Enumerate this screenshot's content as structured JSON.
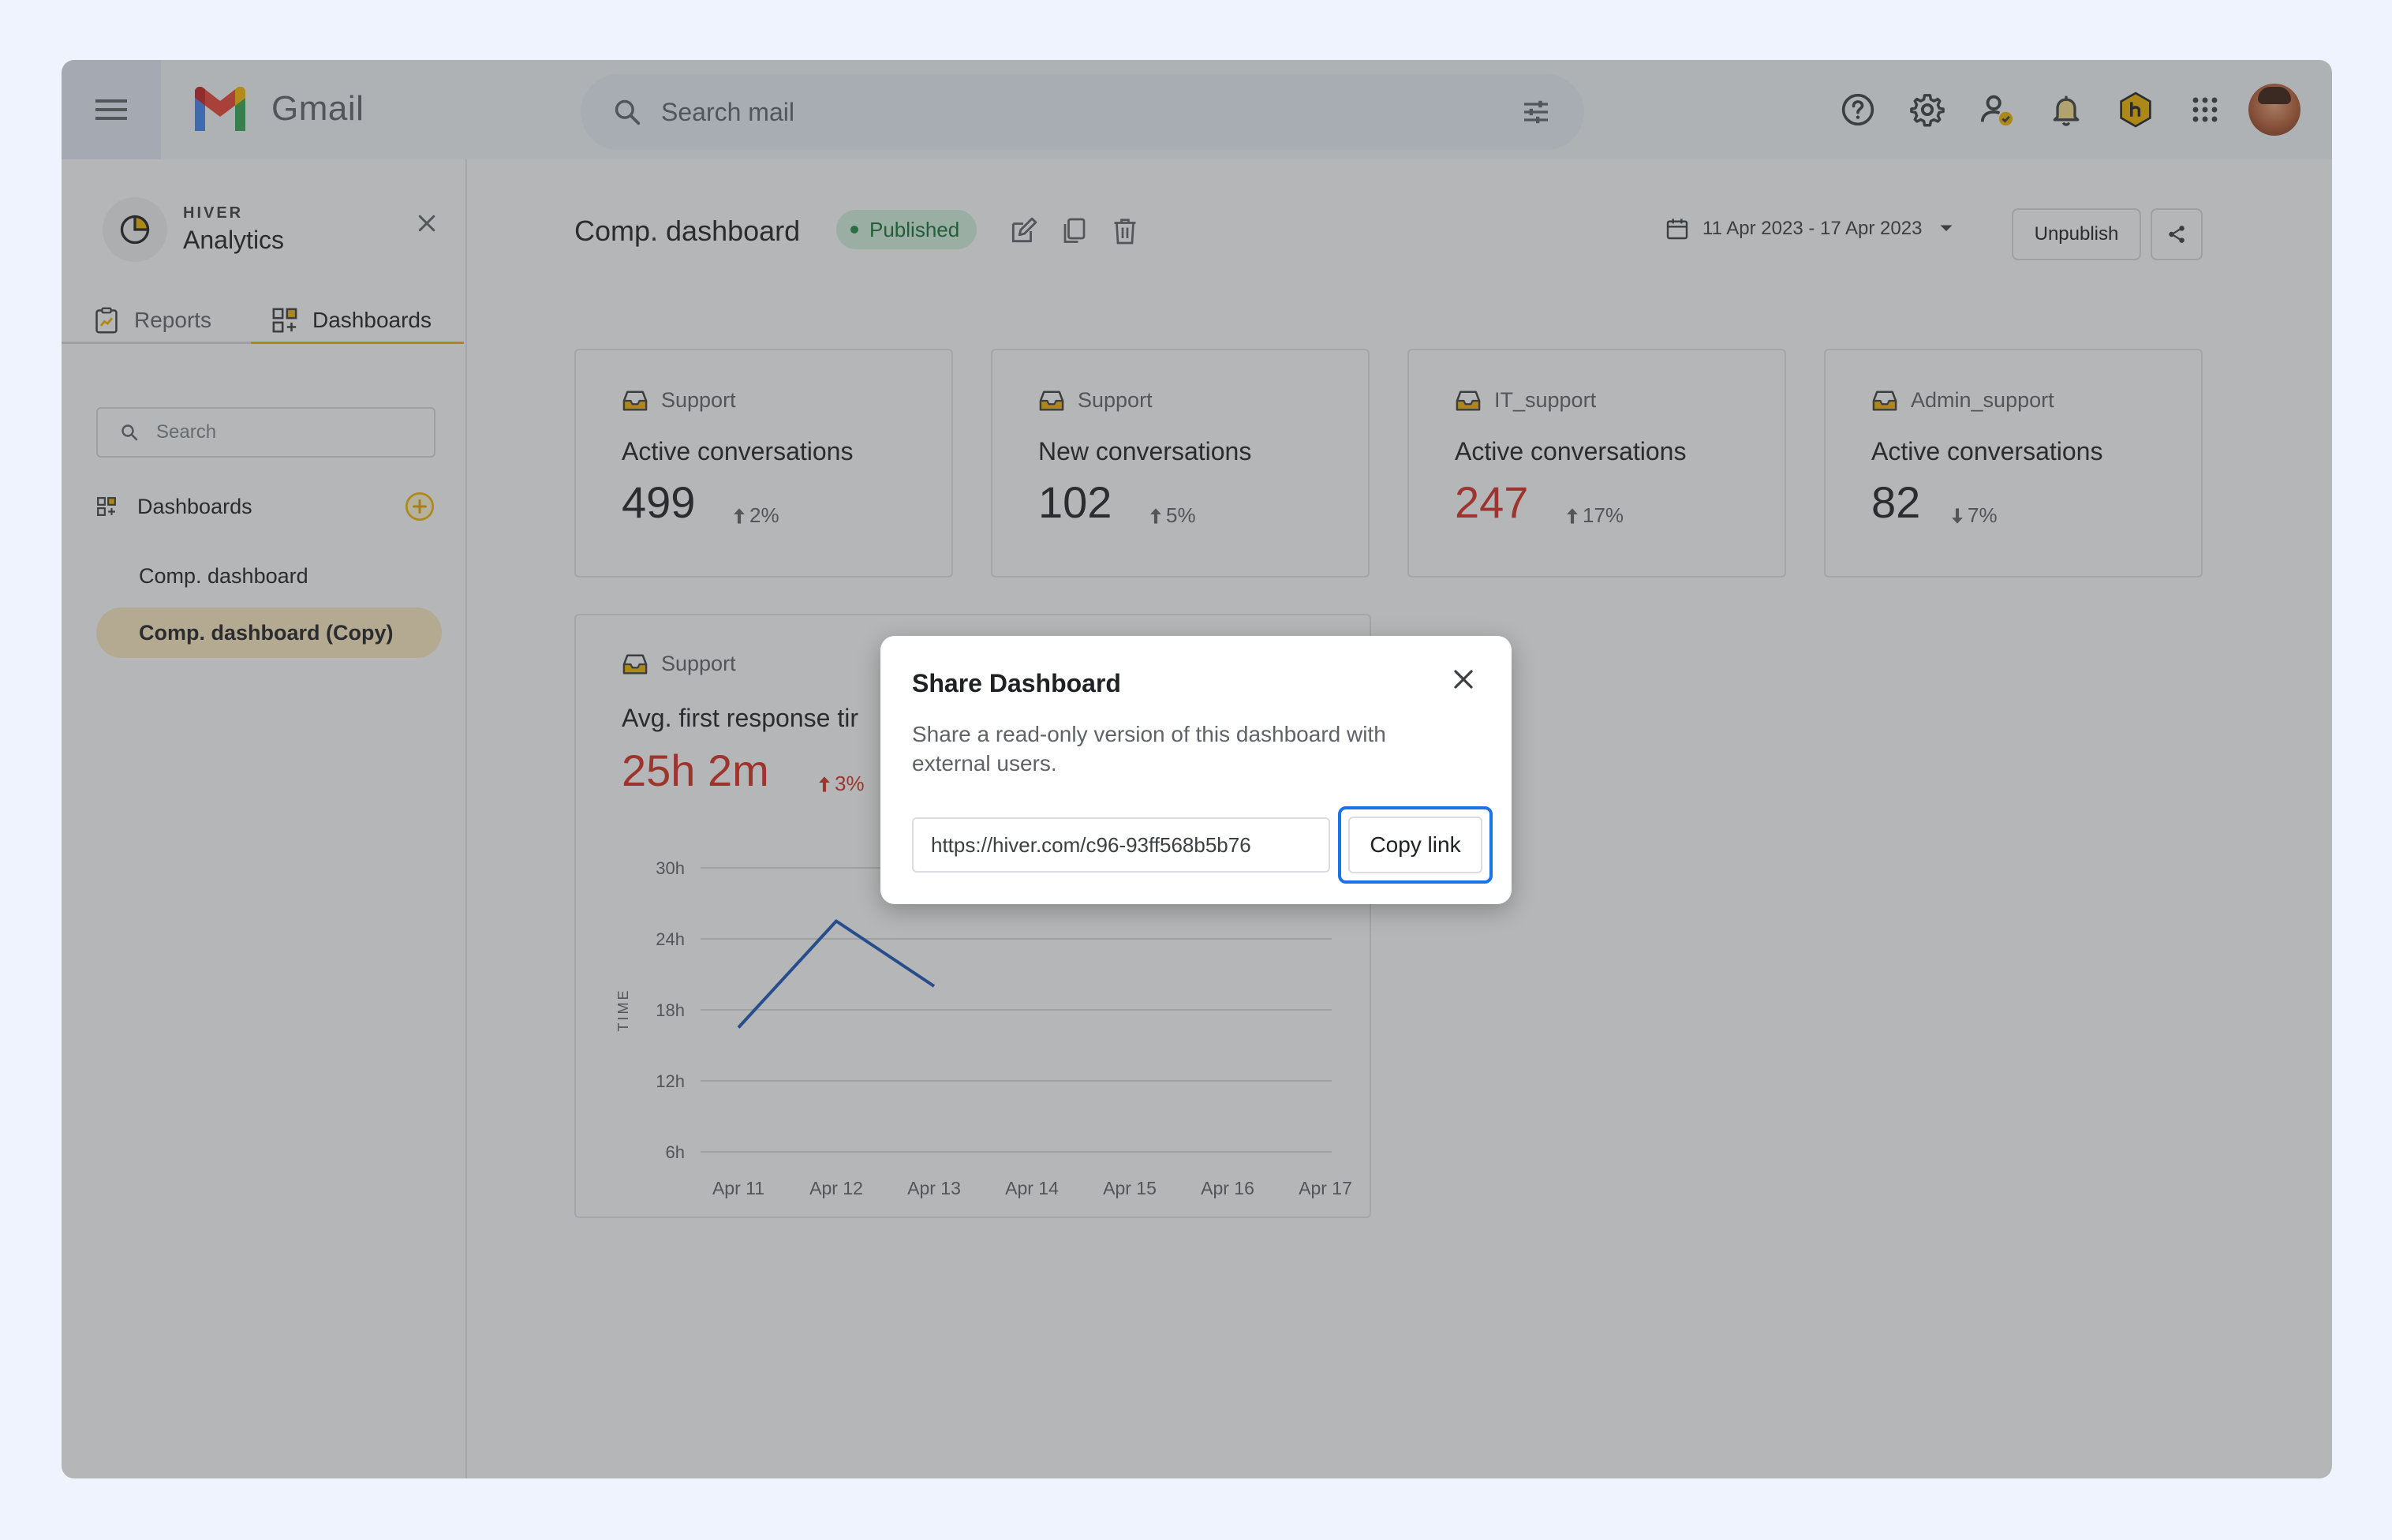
{
  "gmail": {
    "logo_text": "Gmail",
    "search_placeholder": "Search mail"
  },
  "sidebar": {
    "brand": "HIVER",
    "app_name": "Analytics",
    "tabs": [
      {
        "label": "Reports"
      },
      {
        "label": "Dashboards",
        "active": true
      }
    ],
    "search_placeholder": "Search",
    "section_label": "Dashboards",
    "items": [
      {
        "label": "Comp. dashboard"
      },
      {
        "label": "Comp. dashboard (Copy)",
        "selected": true
      }
    ]
  },
  "dashboard": {
    "title": "Comp. dashboard",
    "status": "Published",
    "date_range": "11 Apr 2023 - 17 Apr 2023",
    "unpublish_label": "Unpublish",
    "cards": [
      {
        "team": "Support",
        "metric": "Active conversations",
        "value": "499",
        "delta": "2%",
        "direction": "up"
      },
      {
        "team": "Support",
        "metric": "New conversations",
        "value": "102",
        "delta": "5%",
        "direction": "up"
      },
      {
        "team": "IT_support",
        "metric": "Active conversations",
        "value": "247",
        "delta": "17%",
        "direction": "up",
        "value_color": "#d93025"
      },
      {
        "team": "Admin_support",
        "metric": "Active conversations",
        "value": "82",
        "delta": "7%",
        "direction": "down"
      }
    ],
    "chart_card": {
      "team": "Support",
      "metric": "Avg. first response tir",
      "value": "25h 2m",
      "delta": "3%"
    }
  },
  "chart_data": {
    "type": "line",
    "title": "",
    "xlabel": "",
    "ylabel": "TIME",
    "categories": [
      "Apr 11",
      "Apr 12",
      "Apr 13"
    ],
    "series": [
      {
        "values": [
          16.5,
          25.5,
          20
        ]
      }
    ],
    "y_ticks": [
      "6h",
      "12h",
      "18h",
      "24h",
      "30h"
    ],
    "y_tick_values": [
      6,
      12,
      18,
      24,
      30
    ],
    "x_ticks": [
      "Apr 11",
      "Apr 12",
      "Apr 13",
      "Apr 14",
      "Apr 15",
      "Apr 16",
      "Apr 17"
    ],
    "ylim": [
      6,
      30
    ],
    "grid": true,
    "line_color": "#1a56b8",
    "partially_hidden_by_modal": true
  },
  "modal": {
    "title": "Share Dashboard",
    "description": "Share a read-only version of this dashboard with external users.",
    "link_value": "https://hiver.com/c96-93ff568b5b76",
    "copy_label": "Copy link"
  },
  "colors": {
    "accent": "#f2b500",
    "published_bg": "#d4f2e1",
    "published_text": "#137333",
    "negative": "#d93025",
    "focus": "#1a73e8"
  }
}
